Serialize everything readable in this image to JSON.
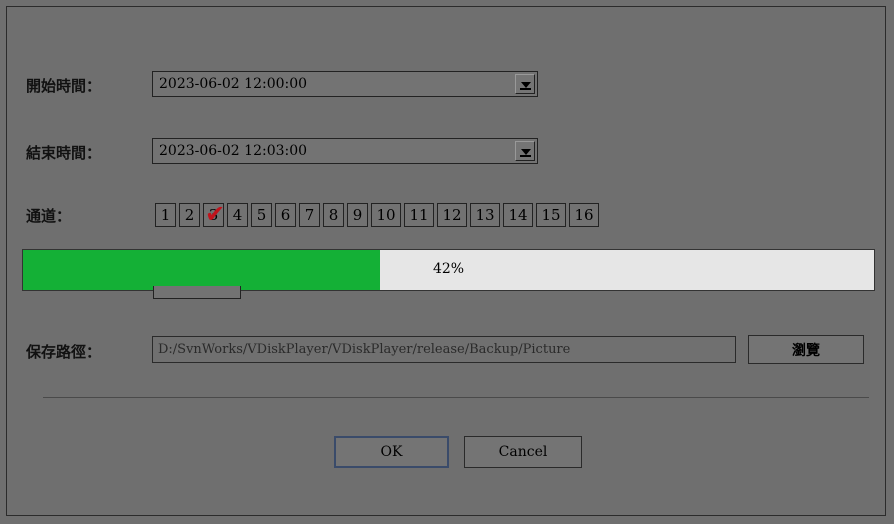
{
  "form": {
    "start_label": "開始時間：",
    "start_value": "2023-06-02 12:00:00",
    "end_label": "結束時間：",
    "end_value": "2023-06-02 12:03:00",
    "channel_label": "通道：",
    "channels": [
      "1",
      "2",
      "3",
      "4",
      "5",
      "6",
      "7",
      "8",
      "9",
      "10",
      "11",
      "12",
      "13",
      "14",
      "15",
      "16"
    ],
    "checked_channel": "3",
    "save_path_label": "保存路徑：",
    "save_path_value": "D:/SvnWorks/VDiskPlayer/VDiskPlayer/release/Backup/Picture",
    "browse_label": "瀏覽"
  },
  "progress": {
    "percent": 42,
    "text": "42%",
    "color": "#14b036"
  },
  "footer": {
    "ok_label": "OK",
    "cancel_label": "Cancel"
  },
  "icons": {
    "dropdown": "chevron-down-icon",
    "check": "check-icon"
  }
}
